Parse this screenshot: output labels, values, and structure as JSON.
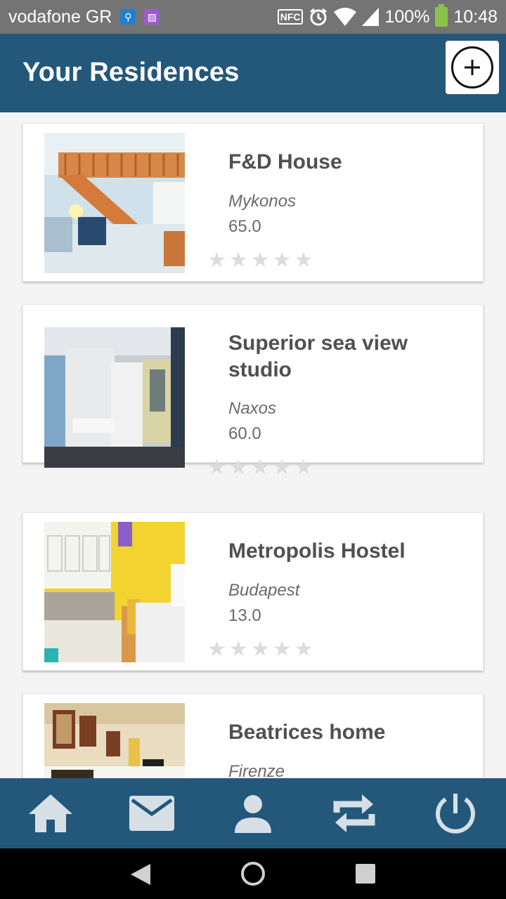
{
  "status_bar": {
    "carrier": "vodafone GR",
    "nfc": "NFC",
    "battery": "100%",
    "time": "10:48"
  },
  "app_bar": {
    "title": "Your Residences",
    "add_icon": "add-circle-icon"
  },
  "residences": [
    {
      "name": "F&D House",
      "city": "Mykonos",
      "price": "65.0",
      "rating": 0,
      "max_rating": 5
    },
    {
      "name": "Superior sea view studio",
      "city": "Naxos",
      "price": "60.0",
      "rating": 0,
      "max_rating": 5
    },
    {
      "name": "Metropolis Hostel",
      "city": "Budapest",
      "price": "13.0",
      "rating": 0,
      "max_rating": 5
    },
    {
      "name": "Beatrices home",
      "city": "Firenze",
      "price": "",
      "rating": 0,
      "max_rating": 5
    }
  ],
  "bottom_nav": {
    "items": [
      "home-icon",
      "mail-icon",
      "person-icon",
      "swap-icon",
      "power-icon"
    ],
    "icon_color": "#d6dfe6",
    "background": "#23587a"
  },
  "colors": {
    "app_bar": "#23587a",
    "star_empty": "#dcdcdc",
    "title_text": "#505050"
  }
}
